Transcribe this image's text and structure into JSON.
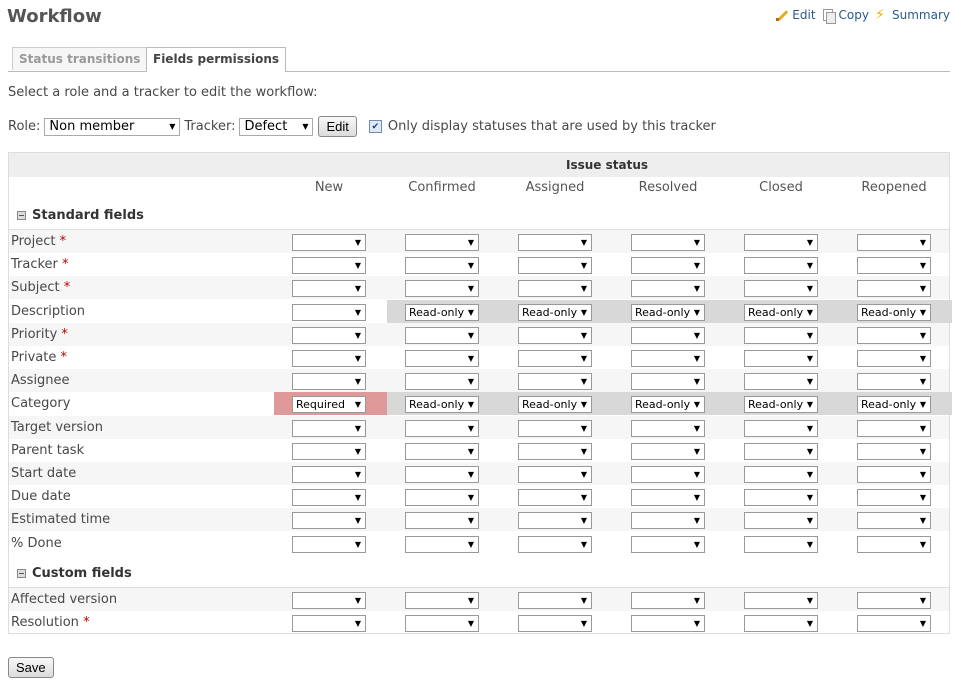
{
  "page": {
    "title": "Workflow",
    "actions": {
      "edit": "Edit",
      "copy": "Copy",
      "summary": "Summary"
    },
    "tabs": [
      "Status transitions",
      "Fields permissions"
    ],
    "intro": "Select a role and a tracker to edit the workflow:",
    "role_label": "Role:",
    "role_value": "Non member",
    "tracker_label": "Tracker:",
    "tracker_value": "Defect",
    "edit_button": "Edit",
    "only_used_label": "Only display statuses that are used by this tracker",
    "only_used_checked": true,
    "save_button": "Save"
  },
  "table": {
    "header": "Issue status",
    "statuses": [
      "New",
      "Confirmed",
      "Assigned",
      "Resolved",
      "Closed",
      "Reopened"
    ],
    "standard_section": "Standard fields",
    "custom_section": "Custom fields",
    "standard_fields": [
      {
        "label": "Project",
        "required": true,
        "values": [
          "",
          "",
          "",
          "",
          "",
          ""
        ]
      },
      {
        "label": "Tracker",
        "required": true,
        "values": [
          "",
          "",
          "",
          "",
          "",
          ""
        ]
      },
      {
        "label": "Subject",
        "required": true,
        "values": [
          "",
          "",
          "",
          "",
          "",
          ""
        ]
      },
      {
        "label": "Description",
        "required": false,
        "values": [
          "",
          "Read-only",
          "Read-only",
          "Read-only",
          "Read-only",
          "Read-only"
        ]
      },
      {
        "label": "Priority",
        "required": true,
        "values": [
          "",
          "",
          "",
          "",
          "",
          ""
        ]
      },
      {
        "label": "Private",
        "required": true,
        "values": [
          "",
          "",
          "",
          "",
          "",
          ""
        ]
      },
      {
        "label": "Assignee",
        "required": false,
        "values": [
          "",
          "",
          "",
          "",
          "",
          ""
        ]
      },
      {
        "label": "Category",
        "required": false,
        "values": [
          "Required",
          "Read-only",
          "Read-only",
          "Read-only",
          "Read-only",
          "Read-only"
        ]
      },
      {
        "label": "Target version",
        "required": false,
        "values": [
          "",
          "",
          "",
          "",
          "",
          ""
        ]
      },
      {
        "label": "Parent task",
        "required": false,
        "values": [
          "",
          "",
          "",
          "",
          "",
          ""
        ]
      },
      {
        "label": "Start date",
        "required": false,
        "values": [
          "",
          "",
          "",
          "",
          "",
          ""
        ]
      },
      {
        "label": "Due date",
        "required": false,
        "values": [
          "",
          "",
          "",
          "",
          "",
          ""
        ]
      },
      {
        "label": "Estimated time",
        "required": false,
        "values": [
          "",
          "",
          "",
          "",
          "",
          ""
        ]
      },
      {
        "label": "% Done",
        "required": false,
        "values": [
          "",
          "",
          "",
          "",
          "",
          ""
        ]
      }
    ],
    "custom_fields": [
      {
        "label": "Affected version",
        "required": false,
        "values": [
          "",
          "",
          "",
          "",
          "",
          ""
        ]
      },
      {
        "label": "Resolution",
        "required": true,
        "values": [
          "",
          "",
          "",
          "",
          "",
          ""
        ]
      }
    ]
  }
}
